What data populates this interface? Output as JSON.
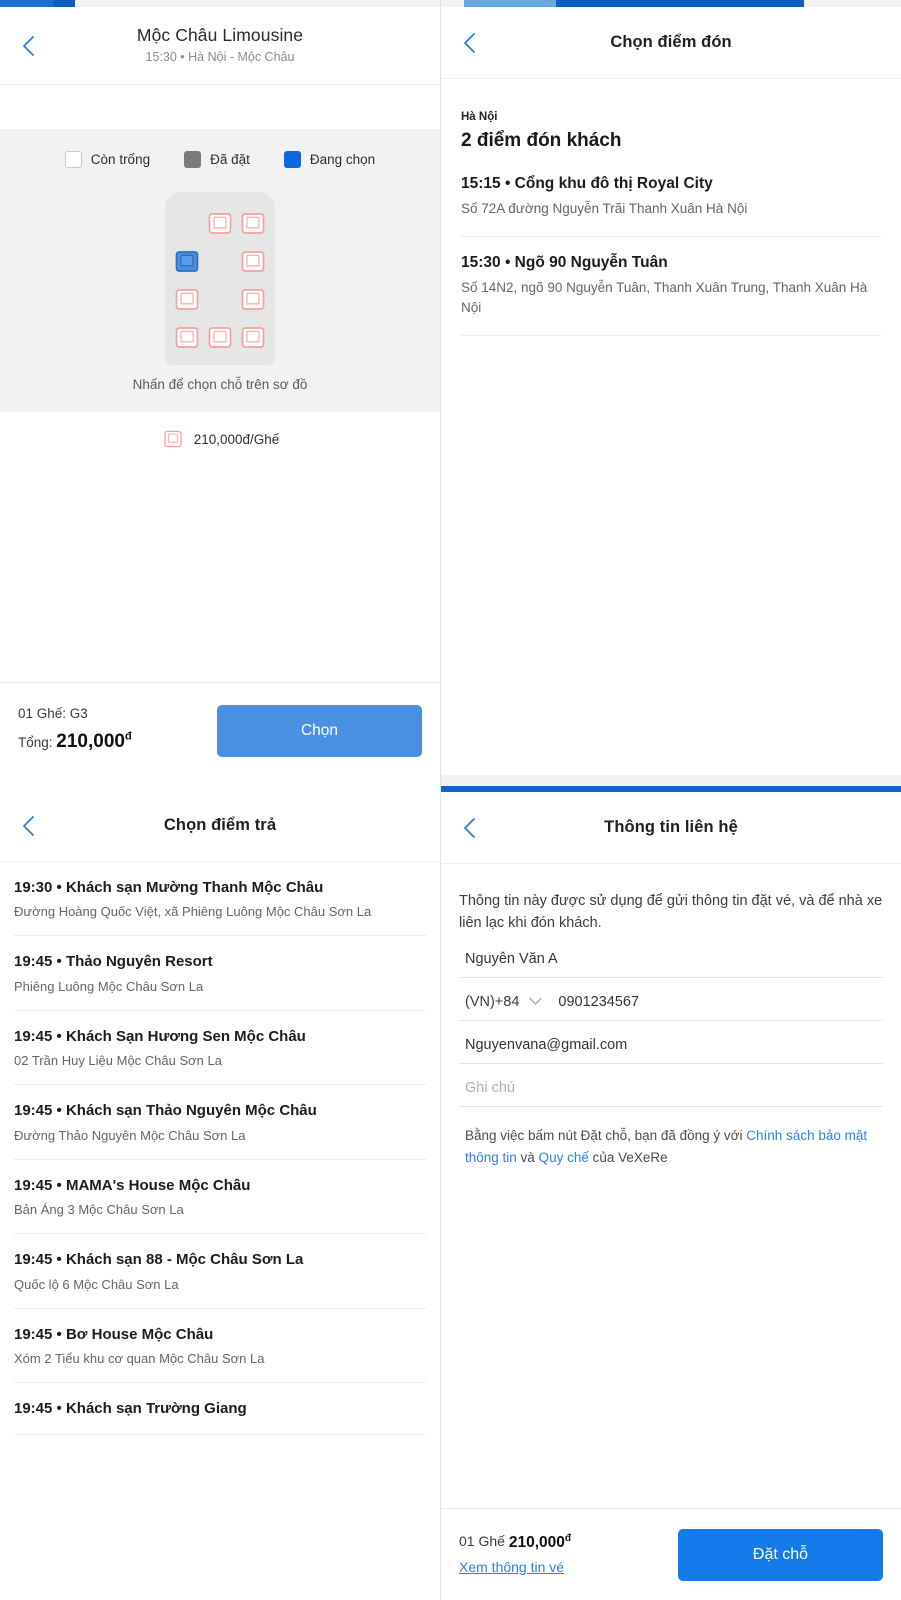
{
  "theme": {
    "accent_blue": "#1479e9",
    "light_blue": "#6aa6e0",
    "button_blue": "#4a90e2",
    "seat_selected": "#4a90e2",
    "seat_empty_outline": "#f4a0a0",
    "taken_gray": "#7b7b7b",
    "link_blue": "#2f80ed"
  },
  "seat_panel": {
    "progress": {
      "filled_pct": 12,
      "dark_pct": 5
    },
    "back_icon": "chevron-left-icon",
    "title": "Mộc Châu Limousine",
    "subtitle": "15:30 • Hà Nội - Mộc Châu",
    "legend": [
      {
        "key": "empty",
        "label": "Còn trống",
        "icon": "empty-seat-swatch"
      },
      {
        "key": "taken",
        "label": "Đã đặt",
        "icon": "taken-seat-swatch"
      },
      {
        "key": "selected",
        "label": "Đang chọn",
        "icon": "selected-seat-swatch"
      }
    ],
    "seat_rows": [
      [
        "blank",
        "empty",
        "empty"
      ],
      [
        "selected",
        "blank",
        "empty"
      ],
      [
        "empty",
        "blank",
        "empty"
      ],
      [
        "empty",
        "empty",
        "empty"
      ]
    ],
    "map_hint": "Nhấn để chọn chỗ trên sơ đồ",
    "price_per_seat": "210,000đ/Ghế",
    "price_icon": "seat-icon",
    "bottom": {
      "seat_summary": "01 Ghế: G3",
      "total_label": "Tổng:",
      "total_value": "210,000",
      "currency": "đ",
      "choose_label": "Chọn"
    }
  },
  "pickup_panel": {
    "progress": {
      "light_pct": 25,
      "dark_pct": 72
    },
    "back_icon": "chevron-left-icon",
    "title": "Chọn điểm đón",
    "city": "Hà Nội",
    "count_label": "2 điểm đón khách",
    "points": [
      {
        "time": "15:15",
        "name": "Cổng khu đô thị Royal City",
        "address": "Số 72A đường Nguyễn Trãi Thanh Xuân Hà Nội"
      },
      {
        "time": "15:30",
        "name": "Ngõ 90 Nguyễn Tuân",
        "address": "Số 14N2, ngõ 90 Nguyễn Tuân, Thanh Xuân Trung, Thanh Xuân Hà Nội"
      }
    ]
  },
  "dropoff_panel": {
    "back_icon": "chevron-left-icon",
    "title": "Chọn điểm trả",
    "points": [
      {
        "time": "19:30",
        "name": "Khách sạn Mường Thanh Mộc Châu",
        "address": "Đường Hoàng Quốc Việt, xã Phiêng Luông Mộc Châu Sơn La"
      },
      {
        "time": "19:45",
        "name": "Thảo Nguyên Resort",
        "address": "Phiêng Luông Mộc Châu Sơn La"
      },
      {
        "time": "19:45",
        "name": "Khách Sạn Hương Sen Mộc Châu",
        "address": "02 Trần Huy Liệu Mộc Châu Sơn La"
      },
      {
        "time": "19:45",
        "name": "Khách sạn Thảo Nguyên Mộc Châu",
        "address": "Đường Thảo Nguyên Mộc Châu Sơn La"
      },
      {
        "time": "19:45",
        "name": "MAMA's House Mộc Châu",
        "address": "Bản Áng 3 Mộc Châu Sơn La"
      },
      {
        "time": "19:45",
        "name": "Khách sạn 88 - Mộc Châu Sơn La",
        "address": "Quốc lộ 6 Mộc Châu Sơn La"
      },
      {
        "time": "19:45",
        "name": "Bơ House Mộc Châu",
        "address": "Xóm 2 Tiểu khu cơ quan Mộc Châu Sơn La"
      },
      {
        "time": "19:45",
        "name": "Khách sạn Trường Giang",
        "address": ""
      }
    ]
  },
  "contact_panel": {
    "back_icon": "chevron-left-icon",
    "title": "Thông tin liên hệ",
    "note": "Thông tin này được sử dụng để gửi thông tin đặt vé, và để nhà xe liên lạc khi đón khách.",
    "fields": {
      "name_value": "Nguyễn Văn A",
      "country_code": "(VN)+84",
      "country_code_icon": "chevron-down-icon",
      "phone_value": "0901234567",
      "email_value": "Nguyenvana@gmail.com",
      "note_placeholder": "Ghi chú"
    },
    "terms": {
      "prefix": "Bằng việc bấm nút Đặt chỗ, bạn đã đồng ý với ",
      "link1": "Chính sách bảo mật thông tin",
      "middle": " và ",
      "link2": "Quy chế",
      "suffix": " của VeXeRe"
    },
    "bottom": {
      "seat_count": "01 Ghế",
      "price": "210,000",
      "currency": "đ",
      "ticket_link": "Xem thông tin vé",
      "book_label": "Đặt chỗ"
    }
  }
}
